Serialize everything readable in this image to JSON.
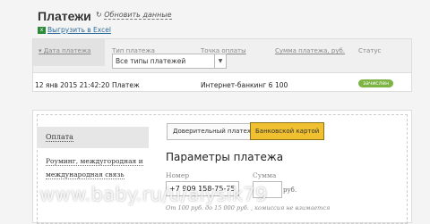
{
  "header": {
    "title": "Платежи",
    "refresh_label": "Обновить данные",
    "refresh_icon": "refresh-icon"
  },
  "export": {
    "icon": "excel-icon",
    "label": "Выгрузить в Excel"
  },
  "table": {
    "columns": [
      "Дата платежа",
      "Тип платежа",
      "Точка оплаты",
      "Сумма платежа, руб.",
      "Статус"
    ],
    "type_filter": "Все типы платежей",
    "rows": [
      {
        "date": "12 янв 2015",
        "time": "21:42:20",
        "type": "Платеж",
        "point": "Интернет-банкинг 6",
        "amount": "100",
        "status": "зачислен"
      }
    ],
    "status_color": "#7cb342"
  },
  "payment_form": {
    "sidebar": [
      "Оплата",
      "Роуминг, междугородная и международная связь"
    ],
    "tabs": [
      "Доверительный платеж",
      "Банковской картой"
    ],
    "active_tab_color": "#f0c030",
    "heading": "Параметры платежа",
    "number_label": "Номер",
    "number_value": "+7 909 158-75-75",
    "amount_label": "Сумма",
    "amount_value": "",
    "currency": "руб.",
    "hint": "От 100 руб. до 15 000 руб. , комиссия не взимается"
  },
  "watermark": "www.baby.ru/u/alysik79"
}
